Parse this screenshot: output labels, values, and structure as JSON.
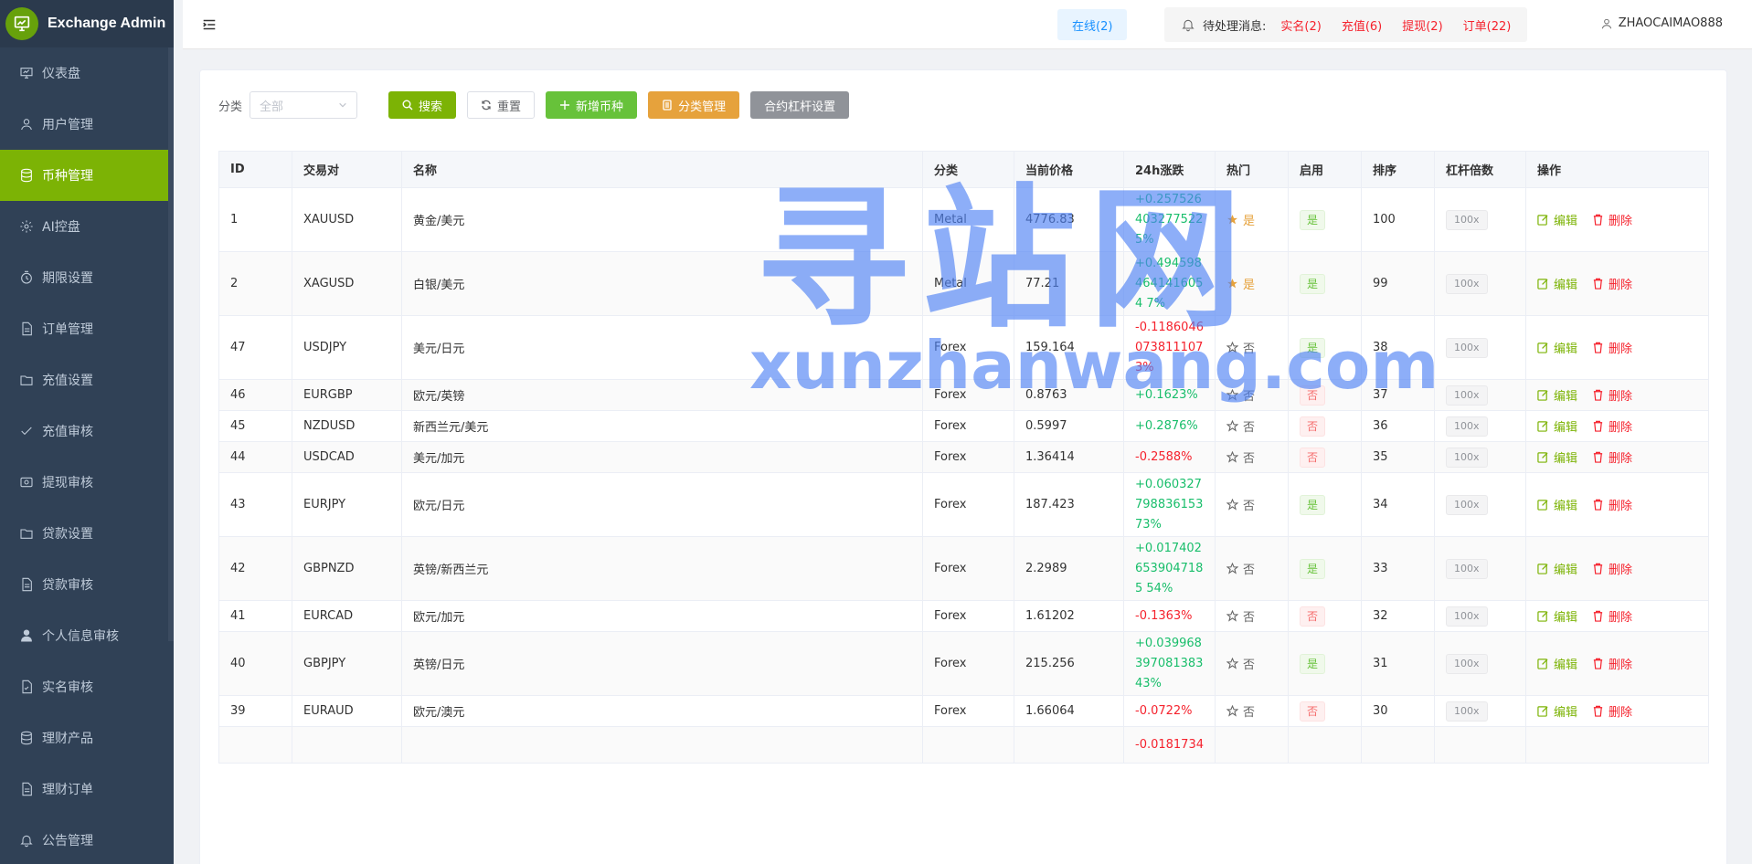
{
  "app": {
    "title": "Exchange Admin"
  },
  "sidebar": {
    "items": [
      {
        "label": "仪表盘",
        "icon": "dashboard-icon"
      },
      {
        "label": "用户管理",
        "icon": "user-icon"
      },
      {
        "label": "币种管理",
        "icon": "database-icon",
        "active": true
      },
      {
        "label": "AI控盘",
        "icon": "gear-icon"
      },
      {
        "label": "期限设置",
        "icon": "timer-icon"
      },
      {
        "label": "订单管理",
        "icon": "document-icon"
      },
      {
        "label": "充值设置",
        "icon": "folder-icon"
      },
      {
        "label": "充值审核",
        "icon": "check-icon"
      },
      {
        "label": "提现审核",
        "icon": "wallet-icon"
      },
      {
        "label": "贷款设置",
        "icon": "folder-icon"
      },
      {
        "label": "贷款审核",
        "icon": "document-icon"
      },
      {
        "label": "个人信息审核",
        "icon": "person-icon"
      },
      {
        "label": "实名审核",
        "icon": "document-check-icon"
      },
      {
        "label": "理财产品",
        "icon": "database-icon"
      },
      {
        "label": "理财订单",
        "icon": "document-icon"
      },
      {
        "label": "公告管理",
        "icon": "bell-icon"
      }
    ]
  },
  "header": {
    "online": "在线(2)",
    "pending_label": "待处理消息:",
    "pending_items": [
      "实名(2)",
      "充值(6)",
      "提现(2)",
      "订单(22)"
    ],
    "user": "ZHAOCAIMAO888"
  },
  "toolbar": {
    "filter_label": "分类",
    "select_placeholder": "全部",
    "search": "搜索",
    "reset": "重置",
    "add": "新增币种",
    "category": "分类管理",
    "leverage": "合约杠杆设置"
  },
  "table": {
    "columns": [
      "ID",
      "交易对",
      "名称",
      "分类",
      "当前价格",
      "24h涨跌",
      "热门",
      "启用",
      "排序",
      "杠杆倍数",
      "操作"
    ],
    "edit_label": "编辑",
    "delete_label": "删除",
    "rows": [
      {
        "id": "1",
        "pair": "XAUUSD",
        "name": "黄金/美元",
        "category": "Metal",
        "price": "4776.83",
        "change": "+0.2575264032775225%",
        "dir": "up",
        "hot": "是",
        "hot_on": true,
        "enabled": "是",
        "enabled_on": true,
        "sort": "100",
        "leverage": "100x"
      },
      {
        "id": "2",
        "pair": "XAGUSD",
        "name": "白银/美元",
        "category": "Metal",
        "price": "77.21",
        "change": "+0.4945984641416054 7%",
        "dir": "up",
        "hot": "是",
        "hot_on": true,
        "enabled": "是",
        "enabled_on": true,
        "sort": "99",
        "leverage": "100x"
      },
      {
        "id": "47",
        "pair": "USDJPY",
        "name": "美元/日元",
        "category": "Forex",
        "price": "159.164",
        "change": "-0.11860460738111073%",
        "dir": "down",
        "hot": "否",
        "hot_on": false,
        "enabled": "是",
        "enabled_on": true,
        "sort": "38",
        "leverage": "100x"
      },
      {
        "id": "46",
        "pair": "EURGBP",
        "name": "欧元/英镑",
        "category": "Forex",
        "price": "0.8763",
        "change": "+0.1623%",
        "dir": "up",
        "hot": "否",
        "hot_on": false,
        "enabled": "否",
        "enabled_on": false,
        "sort": "37",
        "leverage": "100x"
      },
      {
        "id": "45",
        "pair": "NZDUSD",
        "name": "新西兰元/美元",
        "category": "Forex",
        "price": "0.5997",
        "change": "+0.2876%",
        "dir": "up",
        "hot": "否",
        "hot_on": false,
        "enabled": "否",
        "enabled_on": false,
        "sort": "36",
        "leverage": "100x"
      },
      {
        "id": "44",
        "pair": "USDCAD",
        "name": "美元/加元",
        "category": "Forex",
        "price": "1.36414",
        "change": "-0.2588%",
        "dir": "down",
        "hot": "否",
        "hot_on": false,
        "enabled": "否",
        "enabled_on": false,
        "sort": "35",
        "leverage": "100x"
      },
      {
        "id": "43",
        "pair": "EURJPY",
        "name": "欧元/日元",
        "category": "Forex",
        "price": "187.423",
        "change": "+0.06032779883615373%",
        "dir": "up",
        "hot": "否",
        "hot_on": false,
        "enabled": "是",
        "enabled_on": true,
        "sort": "34",
        "leverage": "100x"
      },
      {
        "id": "42",
        "pair": "GBPNZD",
        "name": "英镑/新西兰元",
        "category": "Forex",
        "price": "2.2989",
        "change": "+0.0174026539047185 54%",
        "dir": "up",
        "hot": "否",
        "hot_on": false,
        "enabled": "是",
        "enabled_on": true,
        "sort": "33",
        "leverage": "100x"
      },
      {
        "id": "41",
        "pair": "EURCAD",
        "name": "欧元/加元",
        "category": "Forex",
        "price": "1.61202",
        "change": "-0.1363%",
        "dir": "down",
        "hot": "否",
        "hot_on": false,
        "enabled": "否",
        "enabled_on": false,
        "sort": "32",
        "leverage": "100x"
      },
      {
        "id": "40",
        "pair": "GBPJPY",
        "name": "英镑/日元",
        "category": "Forex",
        "price": "215.256",
        "change": "+0.03996839708138343%",
        "dir": "up",
        "hot": "否",
        "hot_on": false,
        "enabled": "是",
        "enabled_on": true,
        "sort": "31",
        "leverage": "100x"
      },
      {
        "id": "39",
        "pair": "EURAUD",
        "name": "欧元/澳元",
        "category": "Forex",
        "price": "1.66064",
        "change": "-0.0722%",
        "dir": "down",
        "hot": "否",
        "hot_on": false,
        "enabled": "否",
        "enabled_on": false,
        "sort": "30",
        "leverage": "100x"
      },
      {
        "id": "",
        "pair": "",
        "name": "",
        "category": "",
        "price": "",
        "change": "-0.0181734",
        "dir": "down",
        "hot": "",
        "hot_on": false,
        "enabled": "",
        "enabled_on": false,
        "sort": "",
        "leverage": ""
      }
    ]
  },
  "watermark": {
    "big": "寻站网",
    "small": "xunzhanwang.com"
  },
  "colors": {
    "accent": "#7cb305",
    "sidebar": "#304156",
    "up": "#19be6b",
    "down": "#f5222d"
  }
}
